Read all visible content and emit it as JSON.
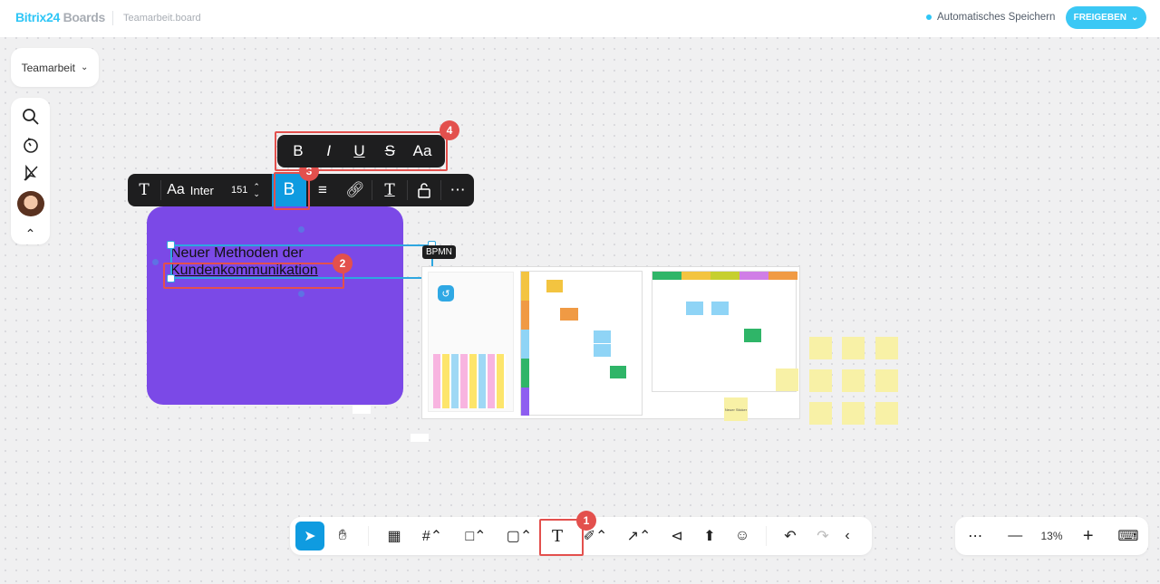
{
  "header": {
    "logo_brand": "Bitrix24",
    "logo_product": "Boards",
    "board_name": "Teamarbeit.board",
    "autosave": "Automatisches Speichern",
    "share_label": "FREIGEBEN"
  },
  "workspace": {
    "label": "Teamarbeit"
  },
  "text_toolbar": {
    "font": "Inter",
    "font_size": "151",
    "font_icon": "Aa"
  },
  "format_toolbar": {
    "bold": "B",
    "italic": "I",
    "underline": "U",
    "strike": "S",
    "case": "Aa"
  },
  "canvas": {
    "text_line1": "Neuer Methoden der",
    "text_line2": "Kundenkommunikation",
    "frame_label": "BPMN",
    "sticker_label": "Neuer Sticker"
  },
  "annotations": [
    "1",
    "2",
    "3",
    "4"
  ],
  "zoom": {
    "level": "13%"
  },
  "colors": {
    "accent": "#2fc6f6",
    "purple": "#7b49e7",
    "highlight": "#e3504d"
  }
}
